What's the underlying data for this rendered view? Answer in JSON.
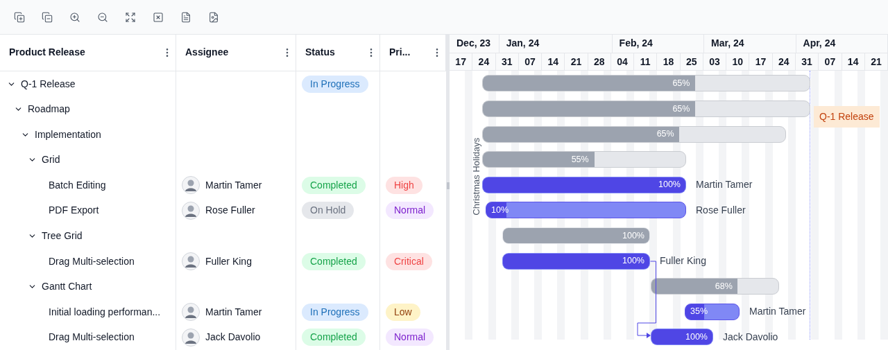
{
  "toolbar": {
    "buttons": [
      {
        "kind": "expand-all"
      },
      {
        "kind": "collapse-all"
      },
      {
        "kind": "zoom-in"
      },
      {
        "kind": "zoom-out"
      },
      {
        "kind": "zoom-to-fit"
      },
      {
        "kind": "excel-export"
      },
      {
        "kind": "csv-export"
      },
      {
        "kind": "pdf-export"
      }
    ]
  },
  "grid": {
    "columns": [
      "Product Release",
      "Assignee",
      "Status",
      "Pri..."
    ],
    "rows": [
      {
        "name": "Q-1 Release",
        "expanded": true,
        "status": {
          "label": "In Progress",
          "kind": "in-progress"
        },
        "bar": {
          "kind": "summary",
          "level": 0.65,
          "progress": "65%"
        },
        "children": [
          {
            "name": "Roadmap",
            "expanded": true,
            "bar": {
              "kind": "summary",
              "level": 0.65,
              "progress": "65%"
            },
            "children": [
              {
                "name": "Implementation",
                "expanded": true,
                "bar": {
                  "kind": "summary",
                  "level": 0.65,
                  "progress": "65%"
                },
                "children": [
                  {
                    "name": "Grid",
                    "expanded": true,
                    "bar": {
                      "kind": "summary",
                      "level": 0.55,
                      "progress": "55%"
                    },
                    "children": [
                      {
                        "name": "Batch Editing",
                        "assignee": "Martin Tamer",
                        "status": {
                          "label": "Completed",
                          "kind": "completed"
                        },
                        "priority": {
                          "label": "High",
                          "kind": "high"
                        },
                        "bar": {
                          "kind": "task",
                          "level": 1,
                          "progress": "100%",
                          "resource": "Martin Tamer"
                        }
                      },
                      {
                        "name": "PDF Export",
                        "assignee": "Rose Fuller",
                        "status": {
                          "label": "On Hold",
                          "kind": "on-hold"
                        },
                        "priority": {
                          "label": "Normal",
                          "kind": "normal"
                        },
                        "bar": {
                          "kind": "task",
                          "level": 0.1,
                          "progress": "10%",
                          "resource": "Rose Fuller"
                        }
                      }
                    ]
                  },
                  {
                    "name": "Tree Grid",
                    "expanded": true,
                    "bar": {
                      "kind": "summary",
                      "level": 1,
                      "progress": "100%"
                    },
                    "children": [
                      {
                        "name": "Drag Multi-selection",
                        "assignee": "Fuller King",
                        "status": {
                          "label": "Completed",
                          "kind": "completed"
                        },
                        "priority": {
                          "label": "Critical",
                          "kind": "critical"
                        },
                        "bar": {
                          "kind": "task",
                          "level": 1,
                          "progress": "100%",
                          "resource": "Fuller King"
                        }
                      }
                    ]
                  },
                  {
                    "name": "Gantt Chart",
                    "expanded": true,
                    "bar": {
                      "kind": "summary",
                      "level": 0.68,
                      "progress": "68%"
                    },
                    "children": [
                      {
                        "name": "Initial loading performan...",
                        "assignee": "Martin Tamer",
                        "status": {
                          "label": "In Progress",
                          "kind": "in-progress"
                        },
                        "priority": {
                          "label": "Low",
                          "kind": "low"
                        },
                        "bar": {
                          "kind": "task",
                          "level": 0.35,
                          "progress": "35%",
                          "resource": "Martin Tamer"
                        }
                      },
                      {
                        "name": "Drag Multi-selection",
                        "assignee": "Jack Davolio",
                        "status": {
                          "label": "Completed",
                          "kind": "completed"
                        },
                        "priority": {
                          "label": "Normal",
                          "kind": "normal"
                        },
                        "bar": {
                          "kind": "task",
                          "level": 1,
                          "progress": "100%",
                          "resource": "Jack Davolio"
                        }
                      }
                    ]
                  }
                ]
              }
            ]
          }
        ]
      }
    ]
  },
  "timeline": {
    "months": [
      {
        "label": "Dec, 23",
        "weeks": [
          "17",
          "24"
        ]
      },
      {
        "label": "Jan, 24",
        "weeks": [
          "31",
          "07",
          "14",
          "21",
          "28"
        ]
      },
      {
        "label": "Feb, 24",
        "weeks": [
          "04",
          "11",
          "18",
          "25"
        ]
      },
      {
        "label": "Mar, 24",
        "weeks": [
          "03",
          "10",
          "17",
          "24"
        ]
      },
      {
        "label": "Apr, 24",
        "weeks": [
          "31",
          "07",
          "14",
          "21"
        ]
      }
    ]
  },
  "holiday": {
    "label": "Christmas Holidays"
  },
  "event_marker": {
    "label": "Q-1 Release"
  }
}
